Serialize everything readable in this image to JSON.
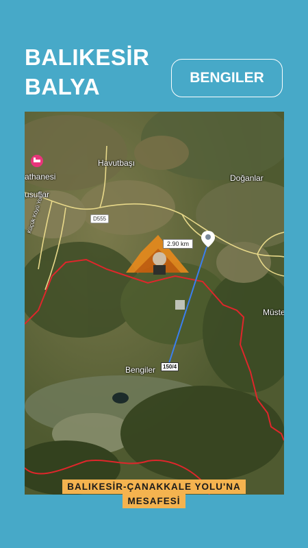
{
  "header": {
    "title_line1": "BALIKESİR",
    "title_line2": "BALYA",
    "place": "BENGILER"
  },
  "map": {
    "labels": {
      "havutbasi": "Havutbaşı",
      "doganlar": "Doğanlar",
      "bengiler": "Bengiler",
      "muste": "Müste",
      "usuflar": "usuflar",
      "athanesi": "athanesi",
      "road_vertical": "Küçük Köyü Yolu"
    },
    "road_shield": "D555",
    "distance": "2.90 km",
    "plot_label": "150/4",
    "colors": {
      "boundary": "#e0262b",
      "measure_line": "#3a7ff0",
      "road": "#e8d98a",
      "poi": "#e9357a"
    }
  },
  "caption": {
    "line1": "BALIKESİR-ÇANAKKALE YOLU'NA",
    "line2": "MESAFESİ"
  }
}
